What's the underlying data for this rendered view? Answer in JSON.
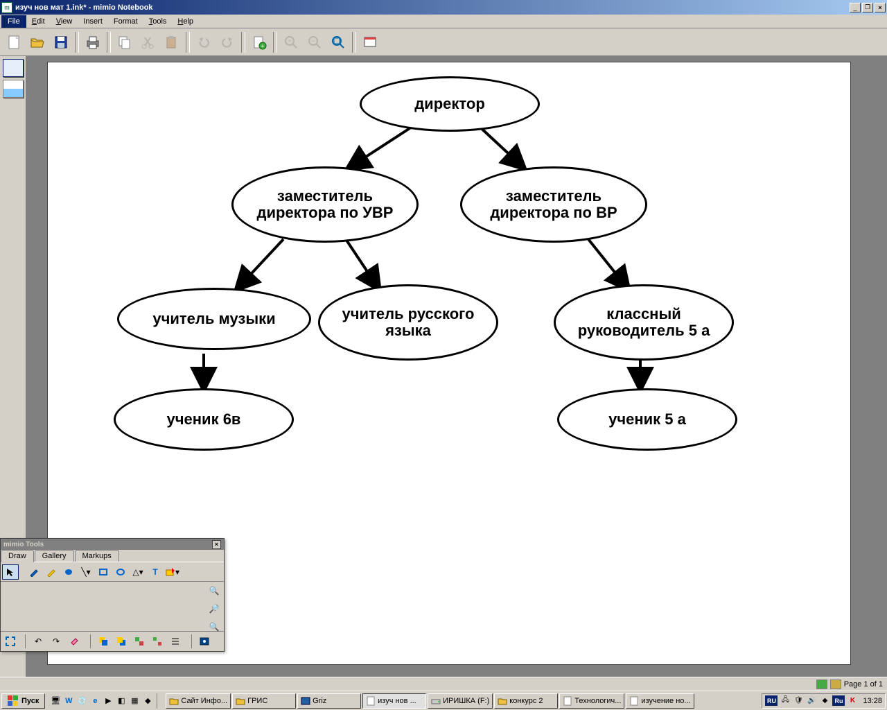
{
  "window": {
    "title": "изуч нов мат 1.ink* - mimio Notebook"
  },
  "menu": {
    "file": "File",
    "edit": "Edit",
    "view": "View",
    "insert": "Insert",
    "format": "Format",
    "tools": "Tools",
    "help": "Help"
  },
  "status": {
    "page": "Page 1 of 1"
  },
  "diagram": {
    "nodes": {
      "n1": "директор",
      "n2": "заместитель директора по УВР",
      "n3": "заместитель директора по ВР",
      "n4": "учитель музыки",
      "n5": "учитель русского языка",
      "n6": "классный руководитель 5 а",
      "n7": "ученик 6в",
      "n8": "ученик 5 а"
    }
  },
  "tools_panel": {
    "title": "mimio Tools",
    "tabs": {
      "draw": "Draw",
      "gallery": "Gallery",
      "markups": "Markups"
    }
  },
  "taskbar": {
    "start": "Пуск",
    "items": [
      {
        "label": "Сайт Инфо...",
        "icon": "folder"
      },
      {
        "label": "ГРИС",
        "icon": "folder"
      },
      {
        "label": "Griz",
        "icon": "app"
      },
      {
        "label": "изуч нов ...",
        "icon": "doc",
        "active": true
      },
      {
        "label": "ИРИШКА (F:)",
        "icon": "drive"
      },
      {
        "label": "конкурс 2",
        "icon": "folder"
      },
      {
        "label": "Технологич...",
        "icon": "doc"
      },
      {
        "label": "изучение но...",
        "icon": "doc"
      }
    ],
    "lang1": "RU",
    "lang2": "Ru",
    "clock": "13:28"
  }
}
